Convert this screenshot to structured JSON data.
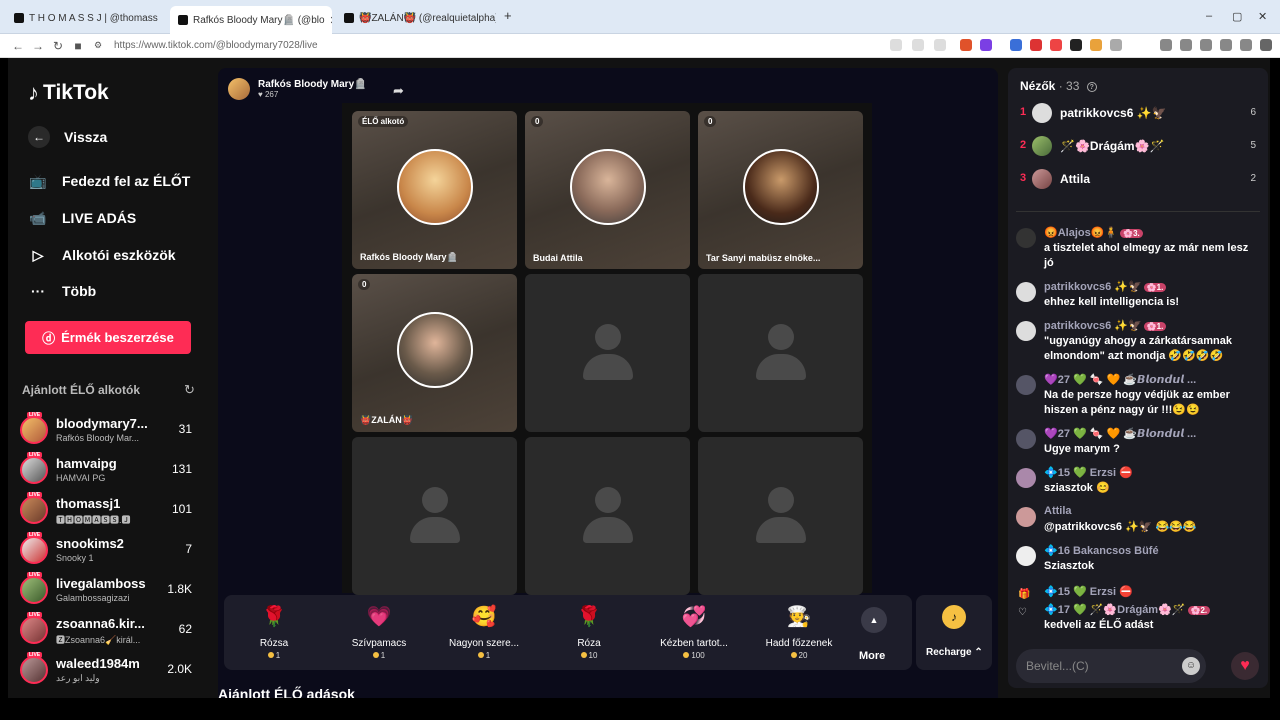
{
  "browser": {
    "tabs": [
      {
        "label": "T H O M A S S J | @thomass",
        "active": false
      },
      {
        "label": "Rafkós Bloody Mary🪦 (@blo",
        "active": true
      },
      {
        "label": "👹ZALÁN👹 (@realquietalpha) ÉLŐ",
        "active": false
      }
    ],
    "new_tab": "+",
    "url": "https://www.tiktok.com/@bloodymary7028/live"
  },
  "sidebar": {
    "logo": "TikTok",
    "back": "Vissza",
    "nav": [
      {
        "label": "Fedezd fel az ÉLŐT",
        "icon": "live-tv-icon"
      },
      {
        "label": "LIVE ADÁS",
        "icon": "camera-icon"
      },
      {
        "label": "Alkotói eszközök",
        "icon": "creator-tools-icon"
      },
      {
        "label": "Több",
        "icon": "more-icon"
      }
    ],
    "coins_button": "Érmék beszerzése",
    "recommended_title": "Ajánlott ÉLŐ alkotók",
    "live_tag": "LIVE",
    "creators": [
      {
        "name": "bloodymary7...",
        "sub": "Rafkós Bloody Mar...",
        "count": "31"
      },
      {
        "name": "hamvaipg",
        "sub": "HAMVAI PG",
        "count": "131"
      },
      {
        "name": "thomassj1",
        "sub": "🆃🅷🅾🅼🅰🆂🆂.🅹",
        "count": "101"
      },
      {
        "name": "snookims2",
        "sub": "Snooky 1",
        "count": "7"
      },
      {
        "name": "livegalamboss",
        "sub": "Galambossagizazi",
        "count": "1.8K"
      },
      {
        "name": "zsoanna6.kir...",
        "sub": "🆉Zsoanna6🧹királ...",
        "count": "62"
      },
      {
        "name": "waleed1984m",
        "sub": "وليد ابو رعد",
        "count": "2.0K"
      }
    ]
  },
  "main": {
    "host_name": "Rafkós Bloody Mary🪦",
    "host_likes": "♥ 267",
    "grid": [
      {
        "label": "Rafkós Bloody Mary🪦",
        "badge": "ÉLŐ alkotó",
        "photo": true
      },
      {
        "label": "Budai Attila",
        "badge": "0",
        "photo": true
      },
      {
        "label": "Tar Sanyi mabüsz elnöke...",
        "badge": "0",
        "photo": true
      },
      {
        "label": "👹ZALÁN👹",
        "badge": "0",
        "photo": true
      },
      {
        "label": "",
        "badge": "",
        "photo": false
      },
      {
        "label": "",
        "badge": "",
        "photo": false
      },
      {
        "label": "",
        "badge": "",
        "photo": false
      },
      {
        "label": "",
        "badge": "",
        "photo": false
      },
      {
        "label": "",
        "badge": "",
        "photo": false
      }
    ],
    "gifts": [
      {
        "name": "Rózsa",
        "price": "1",
        "icon": "🌹"
      },
      {
        "name": "Szívpamacs",
        "price": "1",
        "icon": "💗"
      },
      {
        "name": "Nagyon szere...",
        "price": "1",
        "icon": "🥰"
      },
      {
        "name": "Róza",
        "price": "10",
        "icon": "🌹"
      },
      {
        "name": "Kézben tartot...",
        "price": "100",
        "icon": "💞"
      },
      {
        "name": "Hadd főzzenek",
        "price": "20",
        "icon": "🧑‍🍳"
      }
    ],
    "more_label": "More",
    "recharge_label": "Recharge ⌃",
    "recommended_streams": "Ajánlott ÉLŐ adások"
  },
  "chat": {
    "viewers_label": "Nézők",
    "viewers_count": "· 33",
    "top_viewers": [
      {
        "rank": "1",
        "name": "patrikkovcs6 ✨🦅",
        "score": "6"
      },
      {
        "rank": "2",
        "name": "🪄🌸Drágám🌸🪄",
        "score": "5"
      },
      {
        "rank": "3",
        "name": "Attila",
        "score": "2"
      }
    ],
    "messages": [
      {
        "head": "😡Alajos😡🧍",
        "pill": "🌸3.",
        "text": "a tisztelet ahol elmegy az már nem lesz jó"
      },
      {
        "head": "patrikkovcs6 ✨🦅",
        "pill": "🌸1.",
        "text": "ehhez kell intelligencia is!"
      },
      {
        "head": "patrikkovcs6 ✨🦅",
        "pill": "🌸1.",
        "text": "\"ugyanúgy ahogy a zárkatársamnak elmondom\" azt mondja 🤣🤣🤣🤣"
      },
      {
        "head": "💜27 💚 🍬 🧡 ☕𝘽𝙡𝙤𝙣𝙙𝙪𝙡 ...",
        "pill": "",
        "text": "Na de persze hogy védjük az ember hiszen a pénz nagy úr !!!😉😉"
      },
      {
        "head": "💜27 💚 🍬 🧡 ☕𝘽𝙡𝙤𝙣𝙙𝙪𝙡 ...",
        "pill": "",
        "text": "Ugye marym ?"
      },
      {
        "head": "💠15 💚 Erzsi ⛔",
        "pill": "",
        "text": "sziasztok 😊"
      },
      {
        "head": "Attila",
        "pill": "",
        "text": "@patrikkovcs6 ✨🦅 😂😂😂"
      },
      {
        "head": "💠16 Bakancsos Büfé",
        "pill": "",
        "text": "Sziasztok"
      },
      {
        "head": "💠15 💚 Erzsi ⛔",
        "pill": "",
        "text": ""
      },
      {
        "head": "💠17 💚 🪄🌸Drágám🌸🪄",
        "pill": "🌸2.",
        "text": "kedveli az ÉLŐ adást"
      }
    ],
    "input_placeholder": "Bevitel...(C)"
  },
  "colors": {
    "accent": "#fe2c55",
    "coin": "#f5c042",
    "panel": "#1b1b22"
  }
}
